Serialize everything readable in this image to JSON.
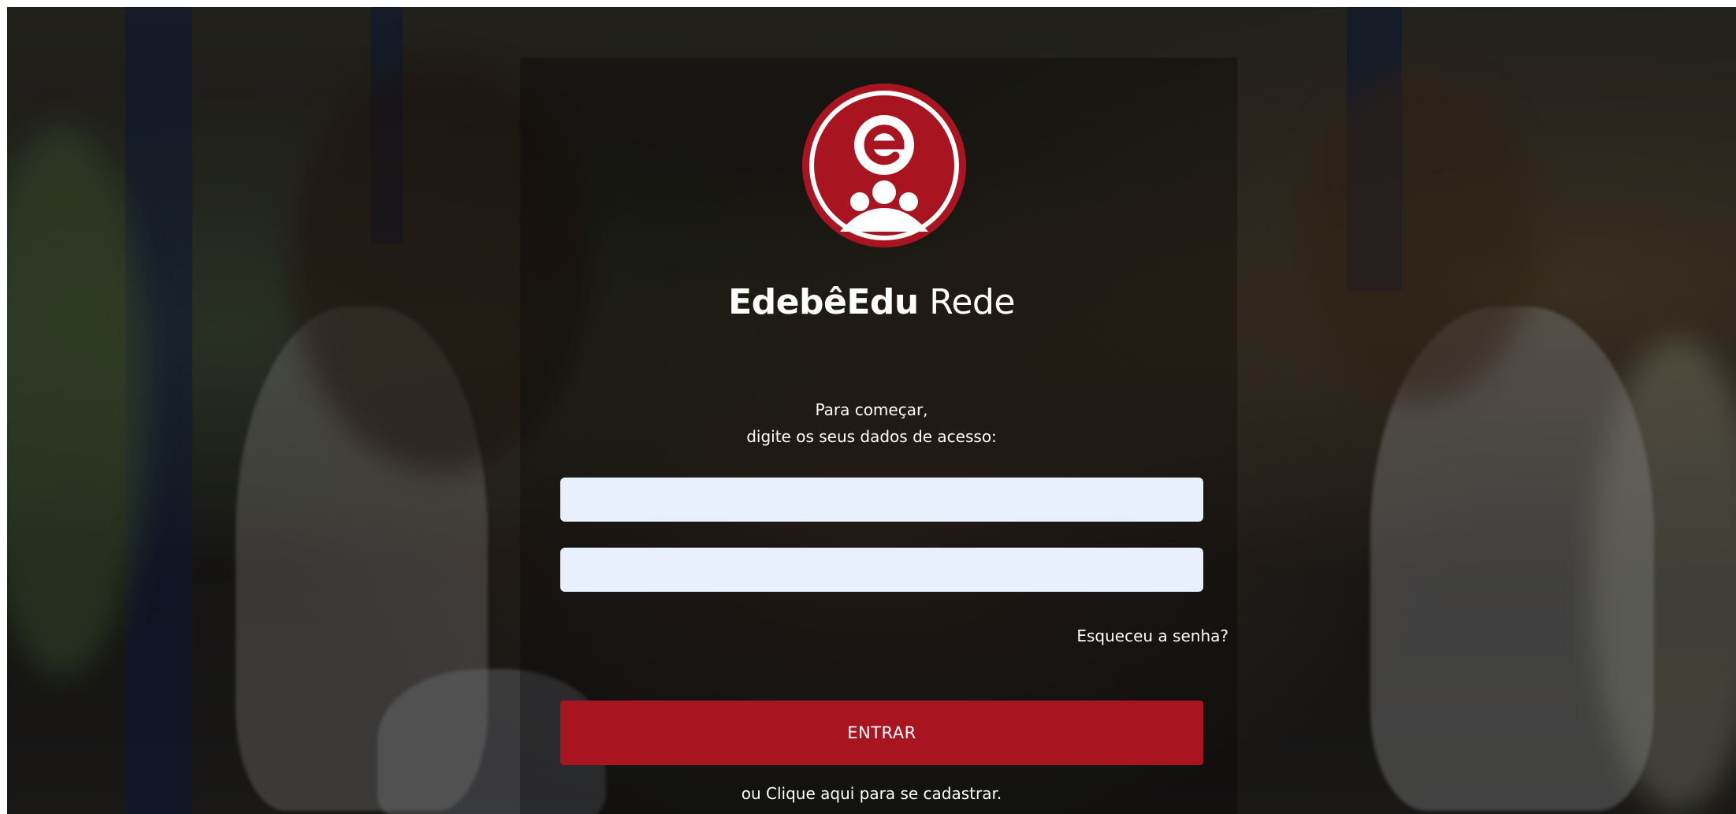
{
  "brand": {
    "name_bold": "EdebêEdu",
    "name_regular": "Rede",
    "logo_icon": "edebe-edu-logo-icon",
    "accent_color": "#a8141f"
  },
  "intro": {
    "line1": "Para começar,",
    "line2": "digite os seus dados de acesso:"
  },
  "form": {
    "username": {
      "value": "",
      "placeholder": ""
    },
    "password": {
      "value": "",
      "placeholder": ""
    },
    "forgot_label": "Esqueceu a senha?",
    "submit_label": "ENTRAR",
    "register_label": "ou Clique aqui para se cadastrar."
  },
  "colors": {
    "input_background": "#e8f0fe",
    "text": "#ffffff"
  }
}
